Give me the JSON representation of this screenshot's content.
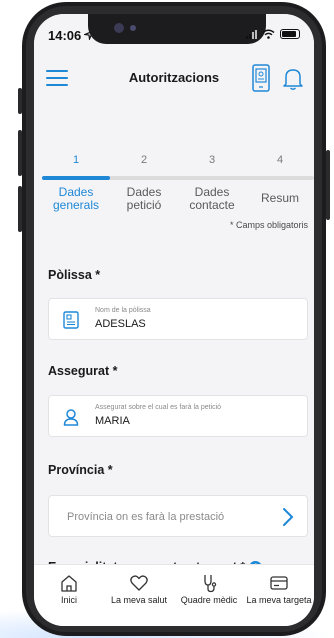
{
  "status_bar": {
    "time": "14:06"
  },
  "header": {
    "title": "Autoritzacions"
  },
  "steps": [
    {
      "number": "1",
      "label_line1": "Dades",
      "label_line2": "generals"
    },
    {
      "number": "2",
      "label_line1": "Dades",
      "label_line2": "petició"
    },
    {
      "number": "3",
      "label_line1": "Dades",
      "label_line2": "contacte"
    },
    {
      "number": "4",
      "label_line1": "Resum",
      "label_line2": ""
    }
  ],
  "progress_fraction": 0.25,
  "required_note": "* Camps obligatoris",
  "form": {
    "policy": {
      "label": "Pòlissa *",
      "caption": "Nom de la pòlissa",
      "value": "ADESLAS"
    },
    "insured": {
      "label": "Assegurat *",
      "caption": "Assegurat sobre el cual es farà la petició",
      "value": "MARIA"
    },
    "province": {
      "label": "Província *",
      "placeholder": "Província on es farà la prestació"
    },
    "specialty": {
      "label": "Especialitat, prova o tractament *"
    }
  },
  "bottom_nav": [
    {
      "label": "Inici",
      "icon": "home-icon"
    },
    {
      "label": "La meva salut",
      "icon": "heart-icon"
    },
    {
      "label": "Quadre mèdic",
      "icon": "stethoscope-icon"
    },
    {
      "label": "La meva targeta",
      "icon": "card-icon"
    }
  ],
  "colors": {
    "accent": "#1e88d7",
    "background": "#f4f4f6"
  }
}
